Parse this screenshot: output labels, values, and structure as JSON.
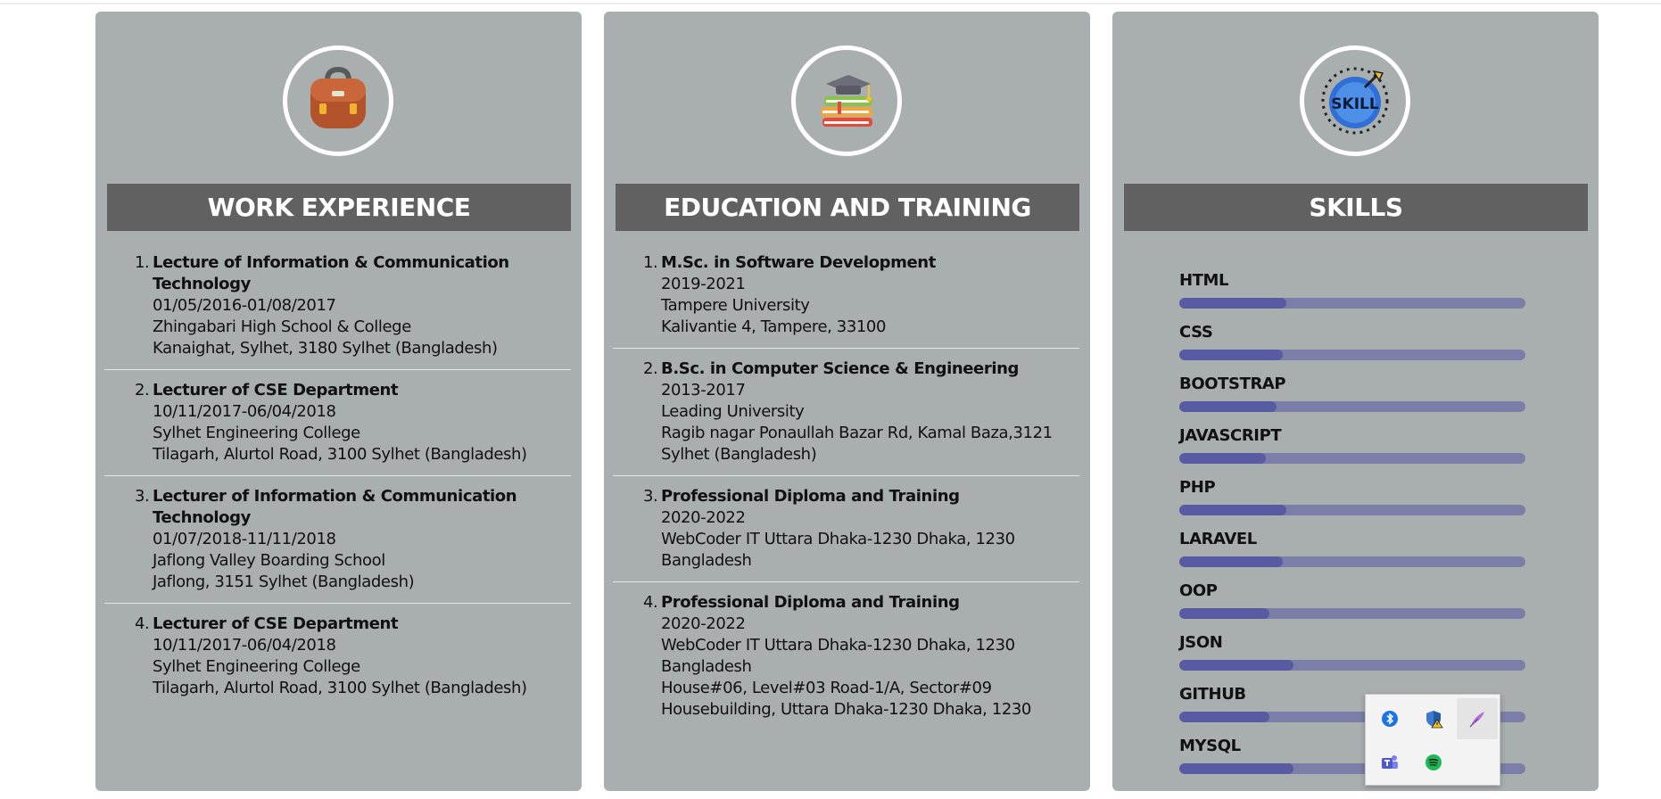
{
  "work": {
    "title": "WORK EXPERIENCE",
    "entries": [
      {
        "num": "1.",
        "title": "Lecture of Information & Communication Technology",
        "lines": [
          "01/05/2016-01/08/2017",
          "Zhingabari High School & College",
          "Kanaighat, Sylhet, 3180 Sylhet (Bangladesh)"
        ]
      },
      {
        "num": "2.",
        "title": "Lecturer of CSE Department",
        "lines": [
          "10/11/2017-06/04/2018",
          "Sylhet Engineering College",
          "Tilagarh, Alurtol Road, 3100 Sylhet (Bangladesh)"
        ]
      },
      {
        "num": "3.",
        "title": "Lecturer of Information & Communication Technology",
        "lines": [
          "01/07/2018-11/11/2018",
          "Jaflong Valley Boarding School",
          "Jaflong, 3151 Sylhet (Bangladesh)"
        ]
      },
      {
        "num": "4.",
        "title": "Lecturer of CSE Department",
        "lines": [
          "10/11/2017-06/04/2018",
          "Sylhet Engineering College",
          "Tilagarh, Alurtol Road, 3100 Sylhet (Bangladesh)"
        ]
      }
    ]
  },
  "education": {
    "title": "EDUCATION AND TRAINING",
    "entries": [
      {
        "num": "1.",
        "title": "M.Sc. in Software Development",
        "lines": [
          "2019-2021",
          "Tampere University",
          "Kalivantie 4, Tampere, 33100"
        ]
      },
      {
        "num": "2.",
        "title": "B.Sc. in Computer Science & Engineering",
        "lines": [
          "2013-2017",
          "Leading University",
          "Ragib nagar Ponaullah Bazar Rd, Kamal Baza,3121 Sylhet (Bangladesh)"
        ]
      },
      {
        "num": "3.",
        "title": "Professional Diploma and Training",
        "lines": [
          "2020-2022",
          "WebCoder IT Uttara Dhaka-1230 Dhaka, 1230 Bangladesh"
        ]
      },
      {
        "num": "4.",
        "title": "Professional Diploma and Training",
        "lines": [
          "2020-2022",
          "WebCoder IT Uttara Dhaka-1230 Dhaka, 1230 Bangladesh",
          "House#06, Level#03 Road-1/A, Sector#09 Housebuilding, Uttara Dhaka-1230 Dhaka, 1230"
        ]
      }
    ]
  },
  "skills": {
    "title": "SKILLS",
    "icon_text": "SKILL",
    "items": [
      {
        "name": "HTML",
        "level": 0.31
      },
      {
        "name": "CSS",
        "level": 0.3
      },
      {
        "name": "BOOTSTRAP",
        "level": 0.28
      },
      {
        "name": "JAVASCRIPT",
        "level": 0.25
      },
      {
        "name": "PHP",
        "level": 0.31
      },
      {
        "name": "LARAVEL",
        "level": 0.3
      },
      {
        "name": "OOP",
        "level": 0.26
      },
      {
        "name": "JSON",
        "level": 0.33
      },
      {
        "name": "GITHUB",
        "level": 0.26
      },
      {
        "name": "MYSQL",
        "level": 0.33
      }
    ]
  },
  "colors": {
    "card_bg": "#a9aeae",
    "title_bar": "#616161",
    "skill_fill": "#585aa2",
    "skill_track": "#7b7fa7"
  },
  "tray_icons": [
    "bluetooth-icon",
    "windows-security-icon",
    "feather-pen-icon",
    "teams-icon",
    "spotify-icon"
  ]
}
